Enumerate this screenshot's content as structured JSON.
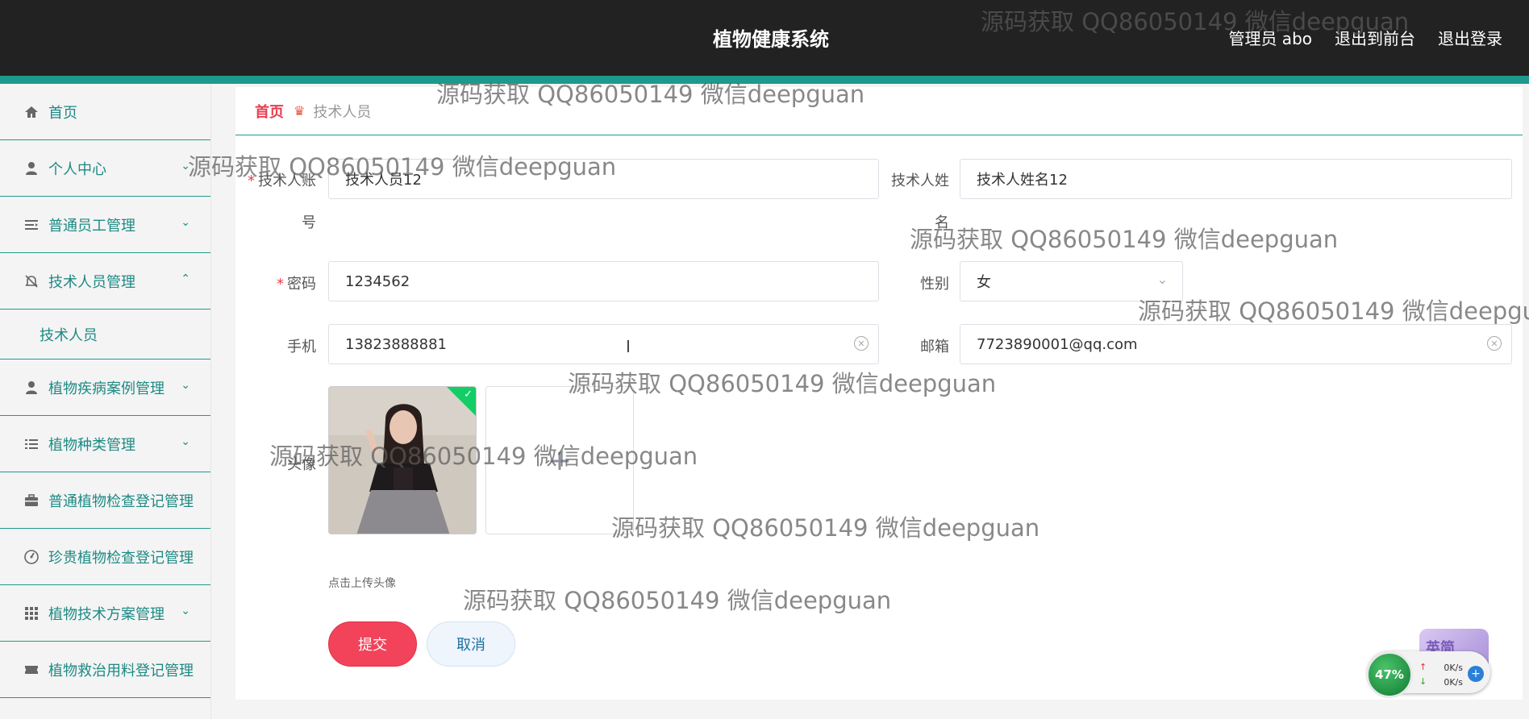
{
  "header": {
    "title": "植物健康系统",
    "user": "管理员 abo",
    "to_front": "退出到前台",
    "logout": "退出登录"
  },
  "sidebar": {
    "items": [
      {
        "label": "首页",
        "icon": "home-icon"
      },
      {
        "label": "个人中心",
        "icon": "user-icon"
      },
      {
        "label": "普通员工管理",
        "icon": "list-icon"
      },
      {
        "label": "技术人员管理",
        "icon": "bell-off-icon"
      },
      {
        "label": "技术人员",
        "icon": ""
      },
      {
        "label": "植物疾病案例管理",
        "icon": "user-icon"
      },
      {
        "label": "植物种类管理",
        "icon": "list-icon"
      },
      {
        "label": "普通植物检查登记管理",
        "icon": "briefcase-icon"
      },
      {
        "label": "珍贵植物检查登记管理",
        "icon": "gauge-icon"
      },
      {
        "label": "植物技术方案管理",
        "icon": "grid-icon"
      },
      {
        "label": "植物救治用料登记管理",
        "icon": "ticket-icon"
      }
    ]
  },
  "breadcrumb": {
    "home": "首页",
    "current": "技术人员"
  },
  "form": {
    "account_label_1": "技术人账",
    "account_label_2": "号",
    "account_value": "技术人员12",
    "name_label_1": "技术人姓",
    "name_label_2": "名",
    "name_value": "技术人姓名12",
    "password_label": "密码",
    "password_value": "1234562",
    "gender_label": "性别",
    "gender_value": "女",
    "phone_label": "手机",
    "phone_value": "13823888881",
    "email_label": "邮箱",
    "email_value": "7723890001@qq.com",
    "avatar_label": "头像",
    "upload_plus": "+",
    "upload_hint": "点击上传头像",
    "submit": "提交",
    "cancel": "取消"
  },
  "watermark": {
    "text": "源码获取 QQ86050149 微信deepguan"
  },
  "net_widget": {
    "percent": "47%",
    "up": "0K/s",
    "down": "0K/s",
    "ime": "英简"
  },
  "colors": {
    "accent": "#1d9a8c",
    "header_bg": "#222222",
    "submit": "#f2435a",
    "link": "#1d8a84"
  }
}
